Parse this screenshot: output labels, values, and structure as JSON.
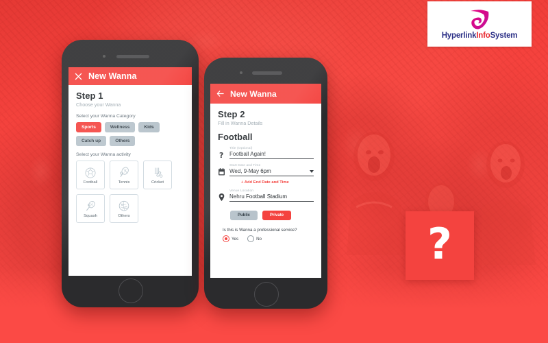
{
  "brand": {
    "logo_text_parts": [
      {
        "text": "Hyperlink",
        "color": "#2b2f86"
      },
      {
        "text": "Info",
        "color": "#e8262c"
      },
      {
        "text": "System",
        "color": "#2b2f86"
      }
    ],
    "logo_name": "Hyperlink InfoSystem",
    "accent_red": "#f4433f",
    "chip_gray": "#b7c3cb"
  },
  "app_icon": {
    "glyph": "?",
    "background": "#f4433f",
    "glyph_color": "#ffffff"
  },
  "phone1": {
    "appbar": {
      "icon": "close-icon",
      "title": "New Wanna"
    },
    "step_title": "Step 1",
    "step_subtitle": "Choose your Wanna",
    "category_label": "Select your Wanna Category",
    "categories": [
      {
        "label": "Sports",
        "selected": true
      },
      {
        "label": "Wellness",
        "selected": false
      },
      {
        "label": "Kids",
        "selected": false
      },
      {
        "label": "Catch up",
        "selected": false
      },
      {
        "label": "Others",
        "selected": false
      }
    ],
    "activity_label": "Select your Wanna activity",
    "activities": [
      {
        "label": "Football",
        "icon": "soccer-ball-icon"
      },
      {
        "label": "Tennis",
        "icon": "tennis-racket-icon"
      },
      {
        "label": "Cricket",
        "icon": "cricket-bat-icon"
      },
      {
        "label": "Squash",
        "icon": "squash-racket-icon"
      },
      {
        "label": "Others",
        "icon": "others-collage-icon"
      }
    ]
  },
  "phone2": {
    "appbar": {
      "icon": "back-arrow-icon",
      "title": "New Wanna"
    },
    "step_title": "Step 2",
    "step_subtitle": "Fill in Wanna Details",
    "activity_title": "Football",
    "fields": [
      {
        "icon": "question-mark-icon",
        "label": "Title (Optional)",
        "value": "Football Again!",
        "caret": false
      },
      {
        "icon": "calendar-icon",
        "label": "Start Date and Time",
        "value": "Wed, 9-May 6pm",
        "caret": true
      },
      {
        "icon": "location-pin-icon",
        "label": "Venue Location",
        "value": "Nehru Football Stadium",
        "caret": false
      }
    ],
    "add_end_link": "+ Add End Date and Time",
    "privacy": {
      "icon": "lock-icon",
      "options": [
        {
          "label": "Public",
          "selected": false
        },
        {
          "label": "Private",
          "selected": true
        }
      ]
    },
    "professional": {
      "icon": "document-icon",
      "question": "Is this is Wanna a professional service?",
      "options": [
        {
          "label": "Yes",
          "selected": true
        },
        {
          "label": "No",
          "selected": false
        }
      ]
    }
  }
}
